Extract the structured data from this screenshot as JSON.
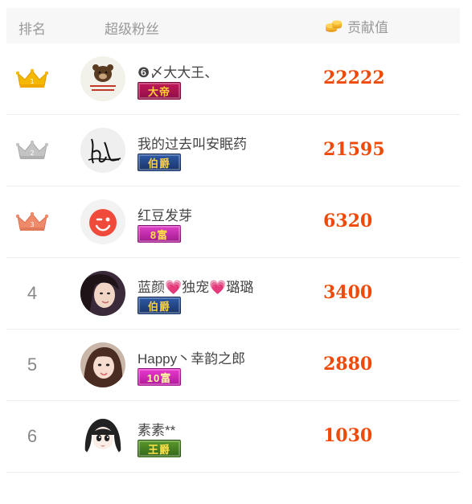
{
  "header": {
    "rank_label": "排名",
    "fans_label": "超级粉丝",
    "contrib_label": "贡献值"
  },
  "rows": [
    {
      "rank": "1",
      "rank_style": "crown-gold",
      "name": "❻〆大大王、",
      "badge": "大帝",
      "badge_style": "dadi",
      "avatar_icon": "bear-avatar",
      "score": "22222"
    },
    {
      "rank": "2",
      "rank_style": "crown-silver",
      "name": "我的过去叫安眠药",
      "badge": "伯爵",
      "badge_style": "bojue",
      "avatar_icon": "signature-avatar",
      "score": "21595"
    },
    {
      "rank": "3",
      "rank_style": "crown-bronze",
      "name": "红豆发芽",
      "badge": "8富",
      "badge_style": "fu8",
      "avatar_icon": "winking-face-avatar",
      "score": "6320"
    },
    {
      "rank": "4",
      "rank_style": "number",
      "name": "蓝颜💗独宠💗璐璐",
      "badge": "伯爵",
      "badge_style": "bojue",
      "avatar_icon": "woman-photo-avatar",
      "score": "3400"
    },
    {
      "rank": "5",
      "rank_style": "number",
      "name": "Happy丶幸韵之郎",
      "badge": "10富",
      "badge_style": "fu10",
      "avatar_icon": "woman-photo-avatar",
      "score": "2880"
    },
    {
      "rank": "6",
      "rank_style": "number",
      "name": "素素**",
      "badge": "王爵",
      "badge_style": "wangjue",
      "avatar_icon": "cartoon-girl-avatar",
      "score": "1030"
    }
  ],
  "colors": {
    "score": "#f04a0a",
    "gold": "#f5b800",
    "silver": "#bbbbbb",
    "bronze": "#ef8a6a"
  }
}
